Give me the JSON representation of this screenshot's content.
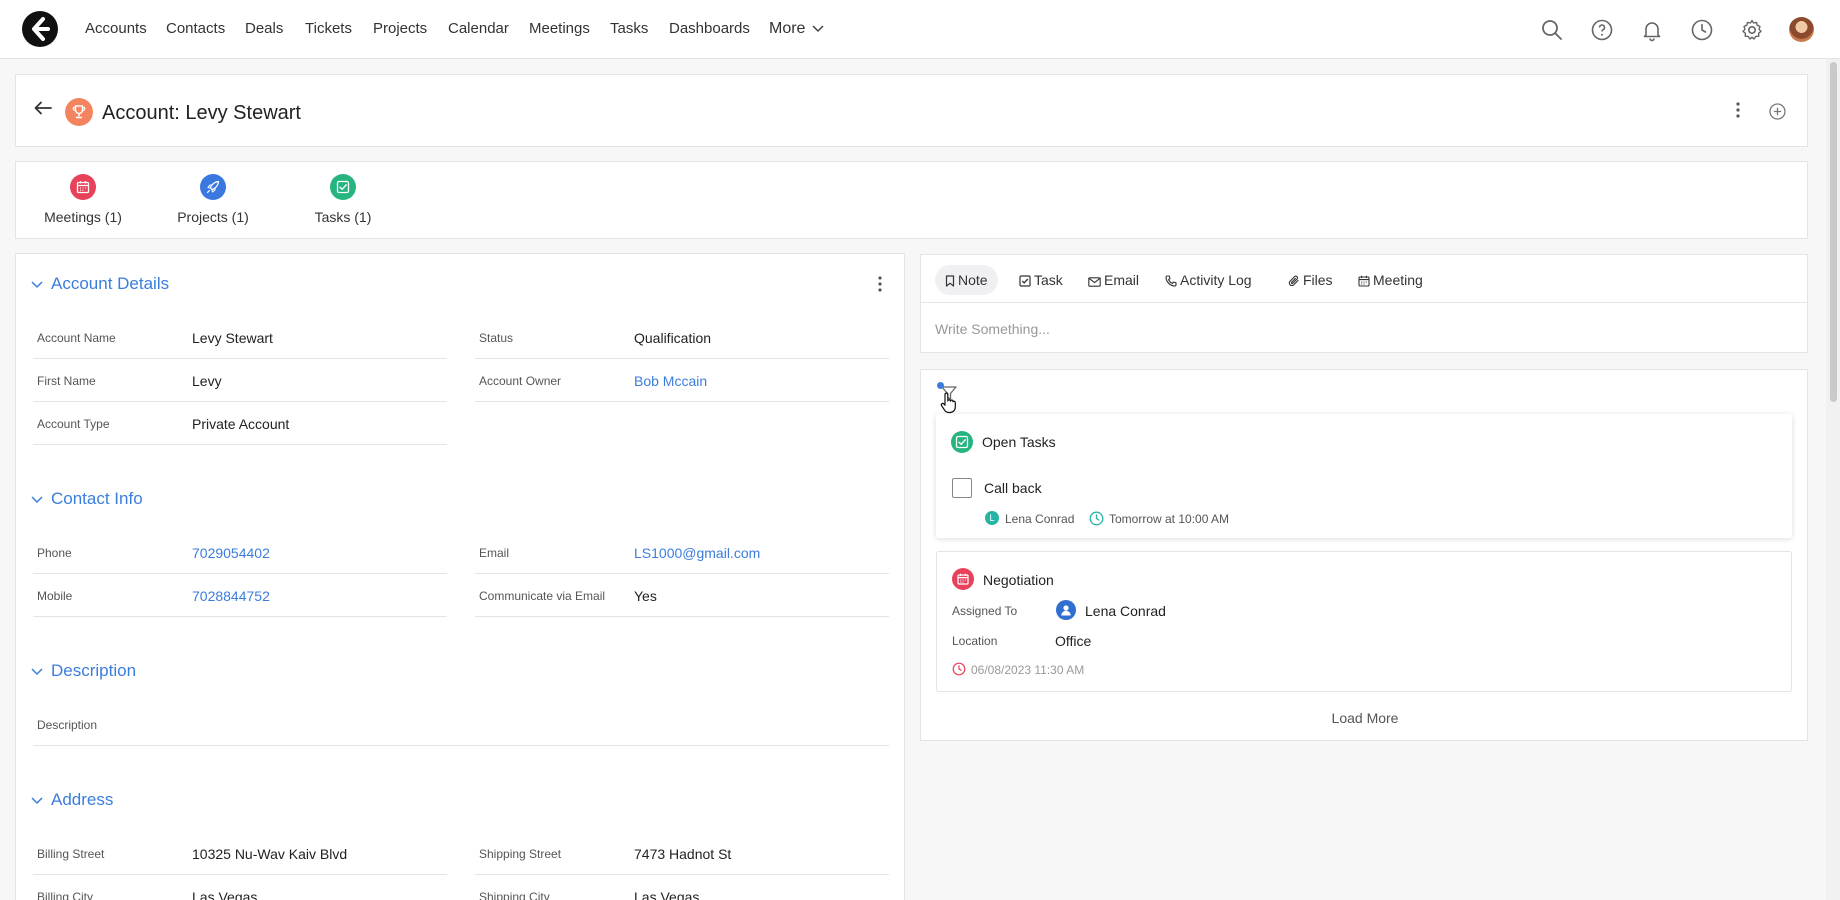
{
  "nav": {
    "links": [
      "Accounts",
      "Contacts",
      "Deals",
      "Tickets",
      "Projects",
      "Calendar",
      "Meetings",
      "Tasks",
      "Dashboards"
    ],
    "more_label": "More",
    "icons": [
      "search-icon",
      "help-icon",
      "bell-icon",
      "clock-icon",
      "gear-icon"
    ]
  },
  "header": {
    "title": "Account: Levy Stewart",
    "badge_icon": "trophy-icon",
    "badge_color": "#f4845f"
  },
  "related": [
    {
      "label": "Meetings (1)",
      "icon": "calendar-icon",
      "color": "#e8425a"
    },
    {
      "label": "Projects (1)",
      "icon": "rocket-icon",
      "color": "#3a78e0"
    },
    {
      "label": "Tasks (1)",
      "icon": "checkbox-icon",
      "color": "#26b47f"
    }
  ],
  "details": {
    "account_details": {
      "title": "Account Details",
      "left": [
        {
          "label": "Account Name",
          "value": "Levy Stewart"
        },
        {
          "label": "First Name",
          "value": "Levy"
        },
        {
          "label": "Account Type",
          "value": "Private Account"
        }
      ],
      "right": [
        {
          "label": "Status",
          "value": "Qualification"
        },
        {
          "label": "Account Owner",
          "value": "Bob Mccain"
        }
      ]
    },
    "contact_info": {
      "title": "Contact Info",
      "left": [
        {
          "label": "Phone",
          "value": "7029054402"
        },
        {
          "label": "Mobile",
          "value": "7028844752"
        }
      ],
      "right": [
        {
          "label": "Email",
          "value": "LS1000@gmail.com"
        },
        {
          "label": "Communicate via Email",
          "value": "Yes"
        }
      ]
    },
    "description": {
      "title": "Description",
      "field_label": "Description"
    },
    "address": {
      "title": "Address",
      "left": [
        {
          "label": "Billing Street",
          "value": "10325 Nu-Wav Kaiv Blvd"
        },
        {
          "label": "Billing City",
          "value": "Las Vegas"
        }
      ],
      "right": [
        {
          "label": "Shipping Street",
          "value": "7473 Hadnot St"
        },
        {
          "label": "Shipping City",
          "value": "Las Vegas"
        }
      ]
    }
  },
  "composer": {
    "tabs": [
      "Note",
      "Task",
      "Email",
      "Activity Log",
      "Files",
      "Meeting"
    ],
    "active_tab": "Note",
    "placeholder": "Write Something..."
  },
  "feed": {
    "open_tasks": {
      "title": "Open Tasks",
      "task": "Call back",
      "owner_initial": "L",
      "owner": "Lena Conrad",
      "due": "Tomorrow at 10:00 AM"
    },
    "meeting": {
      "title": "Negotiation",
      "assigned_label": "Assigned To",
      "assigned_value": "Lena Conrad",
      "location_label": "Location",
      "location_value": "Office",
      "datetime": "06/08/2023 11:30 AM"
    },
    "load_more": "Load More"
  },
  "colors": {
    "accent": "#3b7ddd",
    "green": "#26b47f",
    "red": "#e8425a"
  }
}
